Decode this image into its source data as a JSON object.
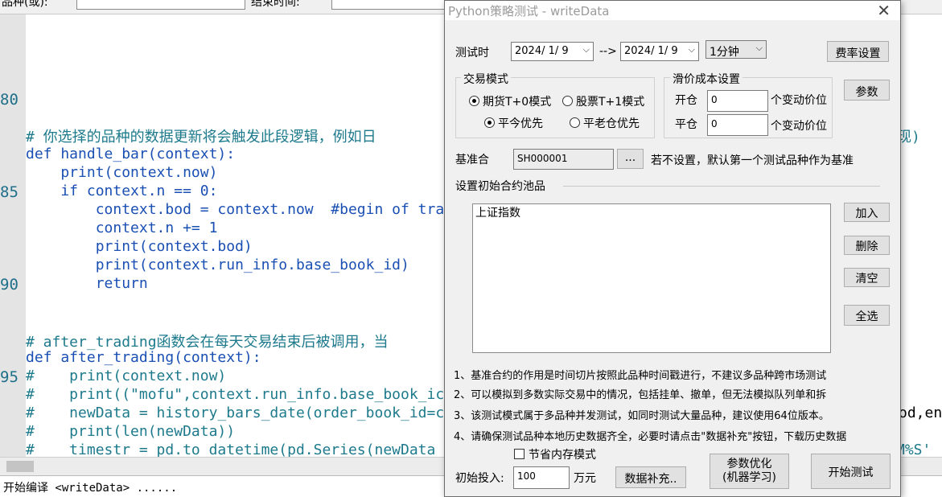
{
  "top_bar": {
    "label1": "品种(或):",
    "label2": "结束时间:"
  },
  "editor": {
    "line_numbers": [
      "80",
      "85",
      "90",
      "95"
    ],
    "lines": [
      {
        "t": "# 你选择的品种的数据更新将会触发此段逻辑，例如日",
        "c": "cm"
      },
      {
        "t": "def handle_bar(context):",
        "c": "kw"
      },
      {
        "t": "    print(context.now)",
        "c": "fn"
      },
      {
        "t": "    if context.n == 0:",
        "c": "kw"
      },
      {
        "t": "        context.bod = context.now  #begin of tra",
        "c": "mix1"
      },
      {
        "t": "        context.n += 1",
        "c": "kw"
      },
      {
        "t": "        print(context.bod)",
        "c": "fn"
      },
      {
        "t": "        print(context.run_info.base_book_id)",
        "c": "fn"
      },
      {
        "t": "        return",
        "c": "kw"
      },
      {
        "t": "# after_trading函数会在每天交易结束后被调用，当",
        "c": "cm"
      },
      {
        "t": "def after_trading(context):",
        "c": "kw"
      },
      {
        "t": "#    print(context.now)",
        "c": "cm"
      },
      {
        "t": "#    print((\"mofu\",context.run_info.base_book_ic",
        "c": "cm"
      },
      {
        "t": "#    newData = history_bars_date(order_book_id=c",
        "c": "cm"
      },
      {
        "t": "#    print(len(newData))",
        "c": "cm"
      },
      {
        "t": "#    timestr = pd.to_datetime(pd.Series(newData",
        "c": "cm"
      }
    ],
    "right_fragments": {
      "xian": "现)",
      "od": "od,en",
      "ms": "M%S'"
    }
  },
  "output": {
    "text": "开始编译 <writeData> ......"
  },
  "dialog": {
    "title": "Python策略测试 - writeData",
    "test_time_label": "测试时",
    "start_date": "2024/ 1/ 9",
    "arrow": "-->",
    "end_date": "2024/ 1/ 9",
    "period": "1分钟",
    "fee_button": "费率设置",
    "trade_mode_title": "交易模式",
    "mode_futures": "期货T+0模式",
    "mode_stocks": "股票T+1模式",
    "close_today": "平今优先",
    "close_old": "平老仓优先",
    "slippage_title": "滑价成本设置",
    "open_label": "开仓",
    "open_value": "0",
    "open_unit": "个变动价位",
    "close_label": "平仓",
    "close_value": "0",
    "close_unit": "个变动价位",
    "params_button": "参数",
    "benchmark_label": "基准合",
    "benchmark_value": "SH000001",
    "browse_button": "...",
    "benchmark_hint": "若不设置，默认第一个测试品种作为基准",
    "pool_title": "设置初始合约池品",
    "pool_items": [
      "上证指数"
    ],
    "add_button": "加入",
    "delete_button": "删除",
    "clear_button": "清空",
    "select_all_button": "全选",
    "notes": [
      "1、基准合约的作用是时间切片按照此品种时间戳进行，不建议多品种跨市场测试",
      "2、可以模拟到多数实际交易中的情况，包括挂单、撤单，但无法模拟队列单和拆",
      "3、该测试模式属于多品种并发测试，如同时测试大量品种，建议使用64位版本。",
      "4、请确保测试品种本地历史数据齐全，必要时请点击\"数据补充\"按钮，下载历史数据"
    ],
    "save_memory": "节省内存模式",
    "initial_label": "初始投入:",
    "initial_value": "100",
    "initial_unit": "万元",
    "data_supplement_button": "数据补充..",
    "optimize_button_line1": "参数优化",
    "optimize_button_line2": "(机器学习)",
    "start_button": "开始测试"
  }
}
